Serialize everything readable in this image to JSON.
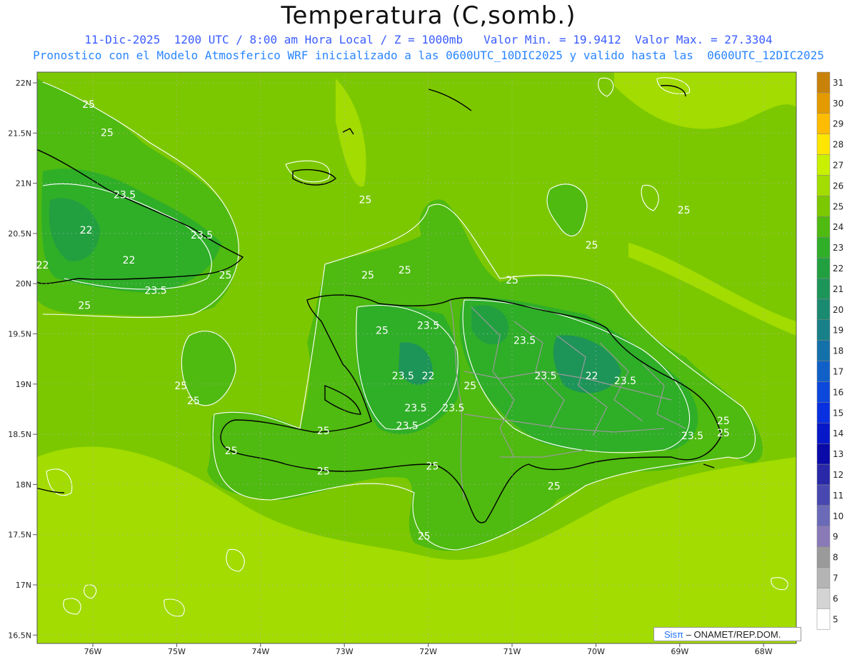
{
  "title": "Temperatura (C,somb.)",
  "subtitle_line1": "11-Dic-2025  1200 UTC / 8:00 am Hora Local / Z = 1000mb   Valor Min. = 19.9412  Valor Max. = 27.3304",
  "subtitle_line2": "Pronostico con el Modelo Atmosferico WRF inicializado a las 0600UTC_10DIC2025 y valido hasta las  0600UTC_12DIC2025",
  "credit": {
    "brand": "Sisπ",
    "text": " – ONAMET/REP.DOM."
  },
  "lat_labels": [
    "22N",
    "21.5N",
    "21N",
    "20.5N",
    "20N",
    "19.5N",
    "19N",
    "18.5N",
    "18N",
    "17.5N",
    "17N",
    "16.5N"
  ],
  "lon_labels": [
    "76W",
    "75W",
    "74W",
    "73W",
    "72W",
    "71W",
    "70W",
    "69W",
    "68W"
  ],
  "colorbar": {
    "levels": [
      31,
      30,
      29,
      28,
      27,
      26,
      25,
      24,
      23,
      22,
      21,
      20,
      19,
      18,
      17,
      16,
      15,
      14,
      13,
      12,
      11,
      10,
      9,
      8,
      7,
      6,
      5
    ],
    "colors": [
      "#c8820a",
      "#e39a00",
      "#ffbc00",
      "#ffe600",
      "#c8f000",
      "#a2dc00",
      "#7cc800",
      "#4fba10",
      "#2fae28",
      "#22a040",
      "#1d9458",
      "#1a8a70",
      "#178088",
      "#1470a8",
      "#1060c8",
      "#0c48dc",
      "#0830e0",
      "#0618c8",
      "#0a0aa8",
      "#2828a8",
      "#4848b0",
      "#6a6ab8",
      "#8a7ab8",
      "#9a9a9a",
      "#b4b4b4",
      "#d4d4d4",
      "#ffffff"
    ]
  },
  "contour_labels": [
    {
      "t": "25",
      "lon": -76.05,
      "lat": 21.75
    },
    {
      "t": "25",
      "lon": -75.83,
      "lat": 21.47
    },
    {
      "t": "23.5",
      "lon": -75.62,
      "lat": 20.85
    },
    {
      "t": "22",
      "lon": -76.08,
      "lat": 20.5
    },
    {
      "t": "22",
      "lon": -75.57,
      "lat": 20.2
    },
    {
      "t": "22",
      "lon": -76.6,
      "lat": 20.15
    },
    {
      "t": "23.5",
      "lon": -74.7,
      "lat": 20.45
    },
    {
      "t": "25",
      "lon": -74.42,
      "lat": 20.05
    },
    {
      "t": "23.5",
      "lon": -75.25,
      "lat": 19.9
    },
    {
      "t": "25",
      "lon": -76.1,
      "lat": 19.75
    },
    {
      "t": "25",
      "lon": -72.75,
      "lat": 20.8
    },
    {
      "t": "25",
      "lon": -72.28,
      "lat": 20.1
    },
    {
      "t": "25",
      "lon": -72.72,
      "lat": 20.05
    },
    {
      "t": "25",
      "lon": -72.55,
      "lat": 19.5
    },
    {
      "t": "25",
      "lon": -71.0,
      "lat": 20.0
    },
    {
      "t": "25",
      "lon": -70.05,
      "lat": 20.35
    },
    {
      "t": "25",
      "lon": -68.95,
      "lat": 20.7
    },
    {
      "t": "23.5",
      "lon": -72.0,
      "lat": 19.55
    },
    {
      "t": "23.5",
      "lon": -72.3,
      "lat": 19.05
    },
    {
      "t": "22",
      "lon": -72.0,
      "lat": 19.05
    },
    {
      "t": "23.5",
      "lon": -72.15,
      "lat": 18.73
    },
    {
      "t": "23.5",
      "lon": -72.25,
      "lat": 18.55
    },
    {
      "t": "23.5",
      "lon": -71.7,
      "lat": 18.73
    },
    {
      "t": "25",
      "lon": -71.5,
      "lat": 18.95
    },
    {
      "t": "23.5",
      "lon": -70.85,
      "lat": 19.4
    },
    {
      "t": "23.5",
      "lon": -70.6,
      "lat": 19.05
    },
    {
      "t": "22",
      "lon": -70.05,
      "lat": 19.05
    },
    {
      "t": "23.5",
      "lon": -69.65,
      "lat": 19.0
    },
    {
      "t": "23.5",
      "lon": -68.85,
      "lat": 18.45
    },
    {
      "t": "25",
      "lon": -68.48,
      "lat": 18.6
    },
    {
      "t": "25",
      "lon": -68.48,
      "lat": 18.48
    },
    {
      "t": "25",
      "lon": -74.95,
      "lat": 18.95
    },
    {
      "t": "25",
      "lon": -74.8,
      "lat": 18.8
    },
    {
      "t": "25",
      "lon": -73.25,
      "lat": 18.5
    },
    {
      "t": "25",
      "lon": -74.35,
      "lat": 18.3
    },
    {
      "t": "25",
      "lon": -73.25,
      "lat": 18.1
    },
    {
      "t": "25",
      "lon": -71.95,
      "lat": 18.15
    },
    {
      "t": "25",
      "lon": -70.5,
      "lat": 17.95
    },
    {
      "t": "25",
      "lon": -72.05,
      "lat": 17.45
    }
  ]
}
